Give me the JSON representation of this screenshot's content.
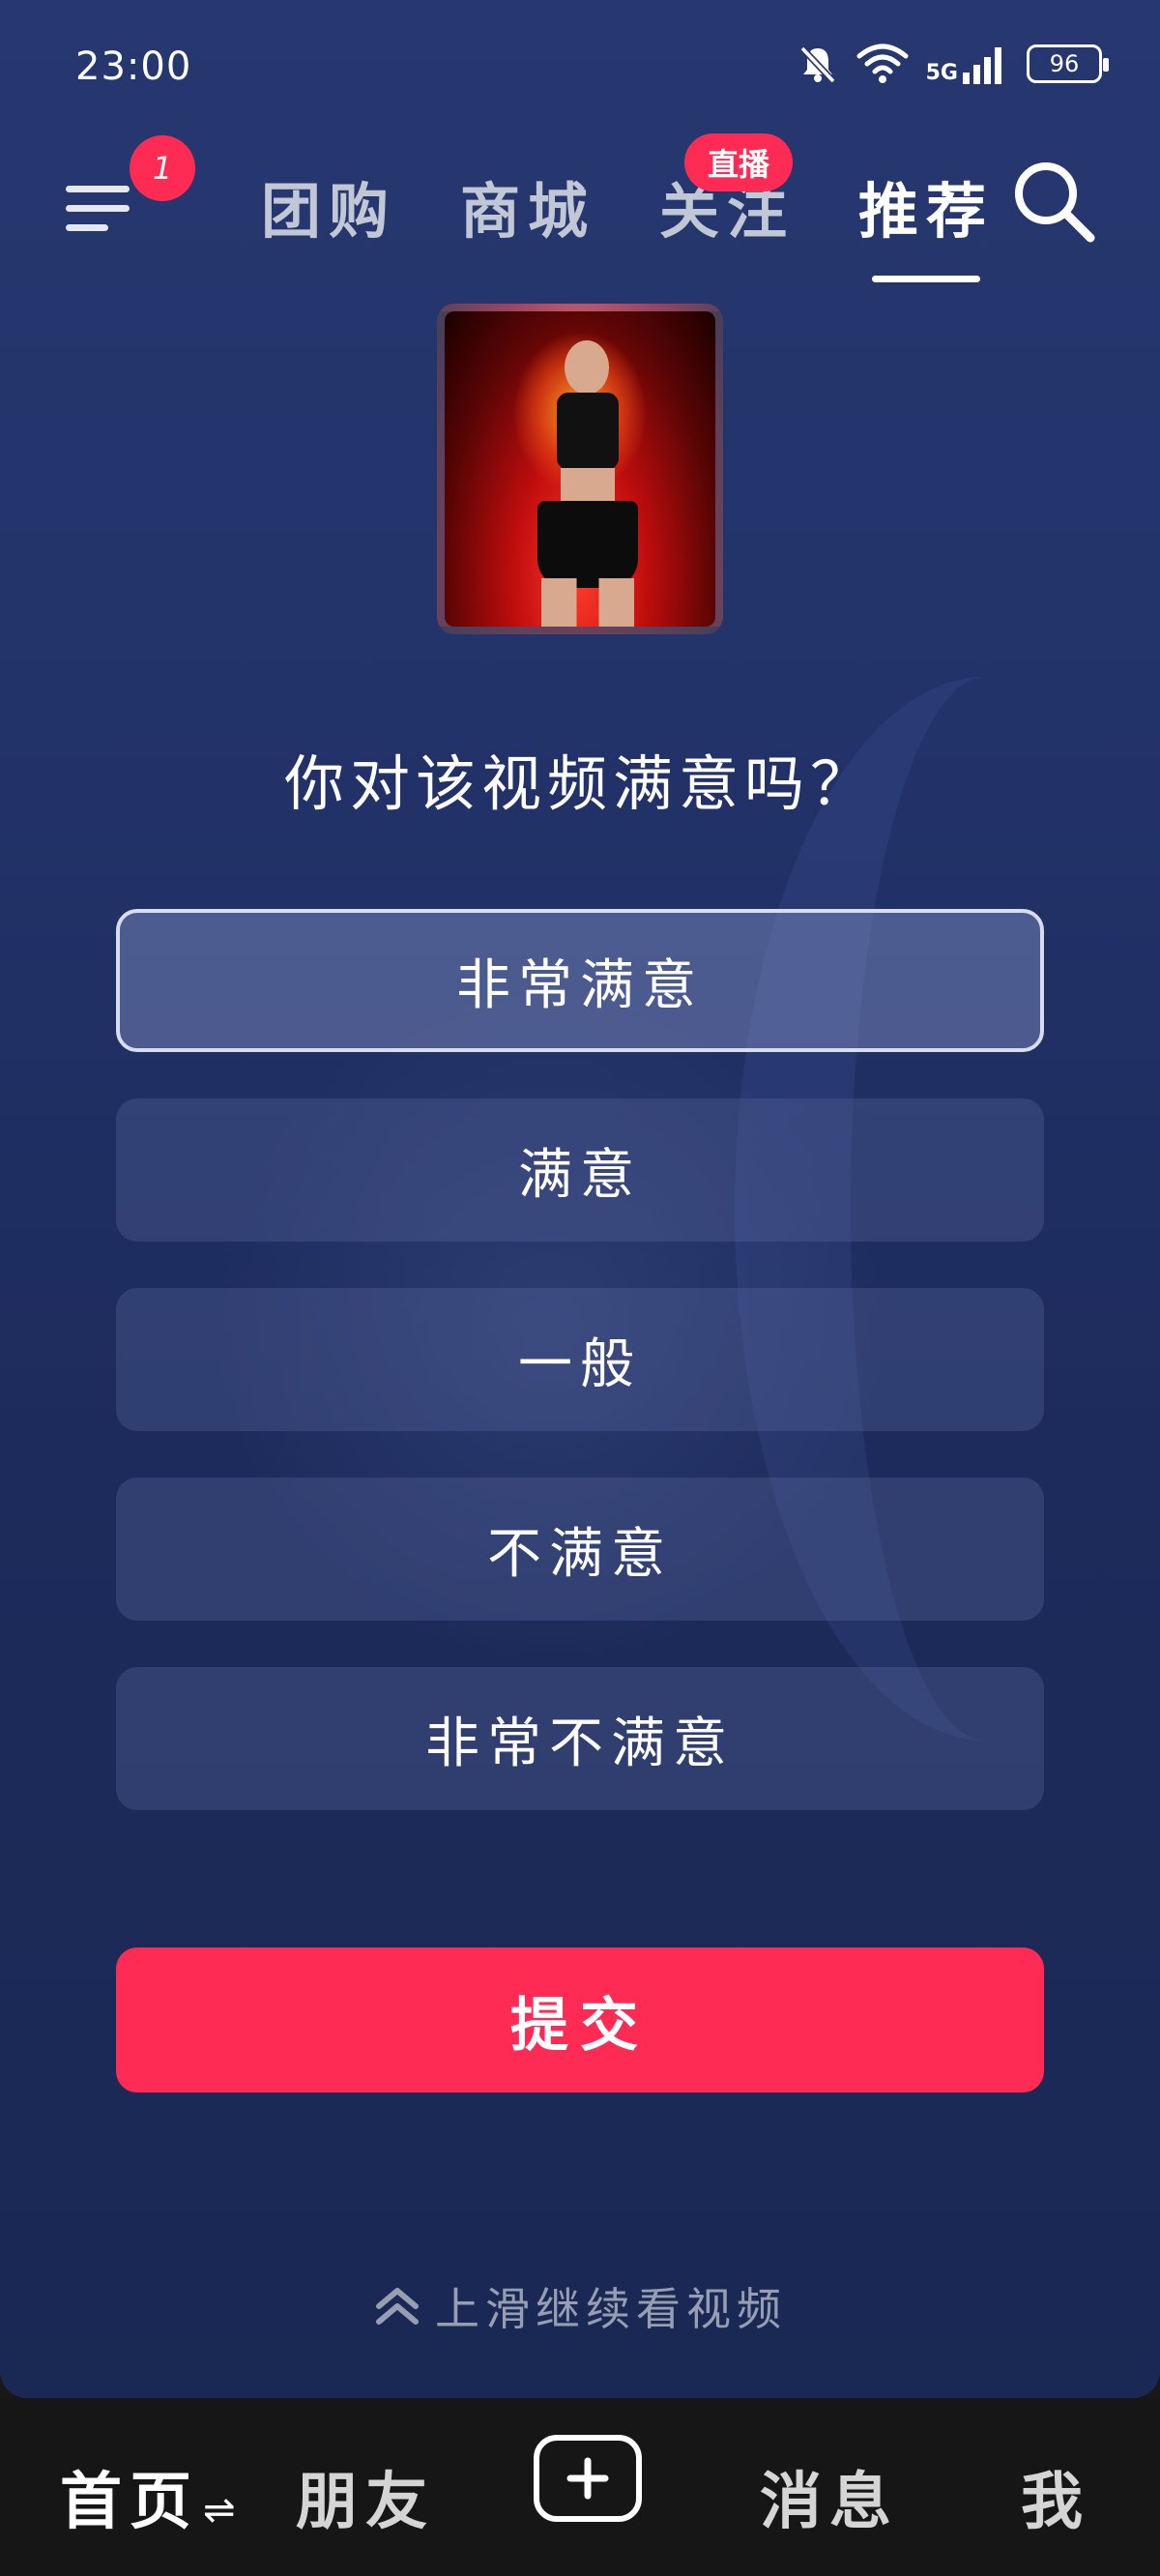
{
  "status_bar": {
    "time": "23:00",
    "network": "5G",
    "battery": "96",
    "icons": [
      "mute-icon",
      "wifi-icon",
      "signal-icon",
      "battery-icon"
    ]
  },
  "top_nav": {
    "menu_badge": "1",
    "tabs": [
      {
        "label": "团购",
        "active": false
      },
      {
        "label": "商城",
        "active": false
      },
      {
        "label": "关注",
        "active": false
      },
      {
        "label": "推荐",
        "active": true
      }
    ],
    "live_badge": "直播"
  },
  "survey": {
    "question": "你对该视频满意吗？",
    "options": [
      {
        "label": "非常满意",
        "selected": true
      },
      {
        "label": "满意",
        "selected": false
      },
      {
        "label": "一般",
        "selected": false
      },
      {
        "label": "不满意",
        "selected": false
      },
      {
        "label": "非常不满意",
        "selected": false
      }
    ],
    "submit_label": "提交",
    "swipe_hint": "上滑继续看视频"
  },
  "bottom_nav": {
    "home": "首页",
    "friends": "朋友",
    "messages": "消息",
    "me": "我"
  },
  "colors": {
    "accent": "#fe2c55",
    "background_top": "#27376f",
    "background_bottom": "#1a2854",
    "bottom_bar": "#161616"
  }
}
